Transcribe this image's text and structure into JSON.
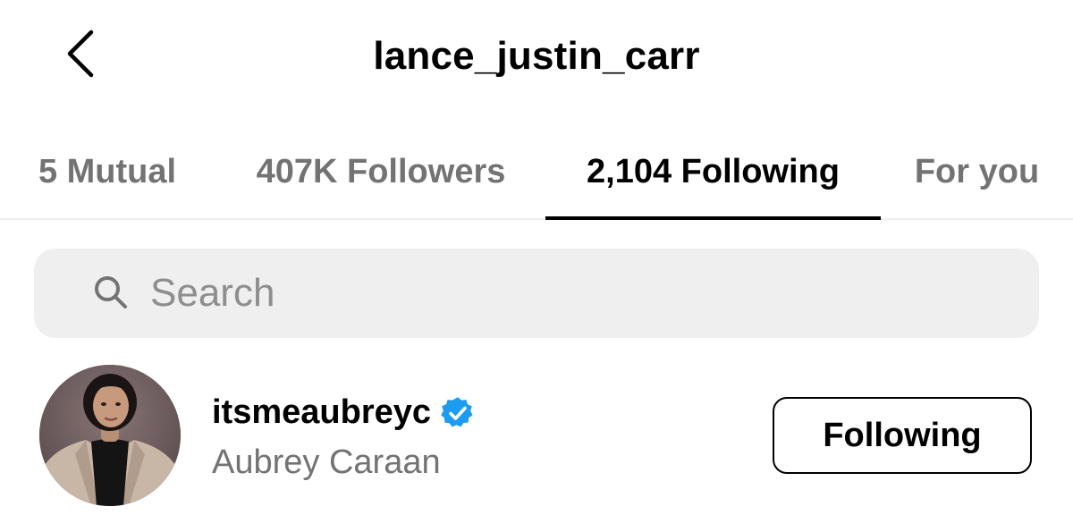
{
  "header": {
    "title": "lance_justin_carr",
    "back_icon": "chevron-left-icon"
  },
  "tabs": [
    {
      "label": "5 Mutual",
      "active": false
    },
    {
      "label": "407K Followers",
      "active": false
    },
    {
      "label": "2,104 Following",
      "active": true
    },
    {
      "label": "For you",
      "active": false
    }
  ],
  "search": {
    "placeholder": "Search",
    "value": "",
    "icon": "search-icon"
  },
  "users": [
    {
      "username": "itsmeaubreyc",
      "verified": true,
      "full_name": "Aubrey Caraan",
      "button_label": "Following"
    }
  ],
  "colors": {
    "text_primary": "#000000",
    "text_secondary": "#737373",
    "search_bg": "#efeff0",
    "verified_blue": "#1d9bf0",
    "divider": "#efefef"
  }
}
